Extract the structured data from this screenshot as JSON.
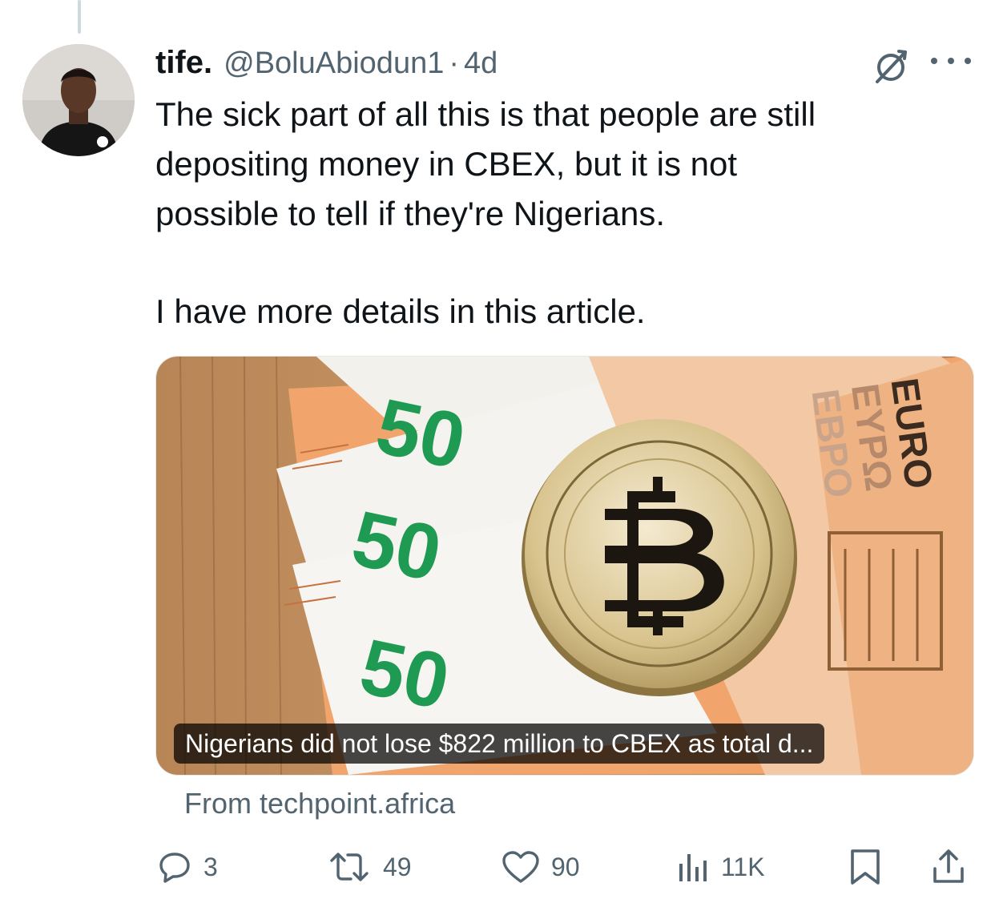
{
  "tweet": {
    "author_name": "tife.",
    "handle": "@BoluAbiodun1",
    "separator": "·",
    "time": "4d",
    "text_lines": [
      "The sick part of all this is that people are still",
      "depositing money in CBEX, but it is not",
      "possible to tell if they're Nigerians."
    ],
    "text_line_2": "I have more details in this article."
  },
  "card": {
    "caption": "Nigerians did not lose $822 million to CBEX as total d...",
    "image_text": {
      "note_values": [
        "50",
        "50",
        "50"
      ],
      "euro": [
        "EURO",
        "EYPΩ",
        "EBPO"
      ]
    },
    "source": "From techpoint.africa"
  },
  "actions": {
    "replies": "3",
    "reposts": "49",
    "likes": "90",
    "views": "11K"
  },
  "icons": {
    "reply": "reply-icon",
    "repost": "repost-icon",
    "like": "heart-icon",
    "views": "views-icon",
    "bookmark": "bookmark-icon",
    "share": "share-icon",
    "grok": "grok-icon",
    "more": "more-icon"
  },
  "colors": {
    "text": "#0f1419",
    "secondary": "#536471",
    "thread_line": "#cfd9de"
  }
}
